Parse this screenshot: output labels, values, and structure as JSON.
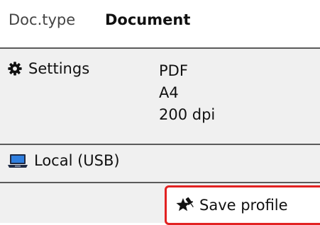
{
  "doc_type": {
    "label": "Doc.type",
    "value": "Document"
  },
  "settings": {
    "label": "Settings",
    "icon": "gear-icon",
    "values": [
      "PDF",
      "A4",
      "200 dpi"
    ]
  },
  "destination": {
    "label": "Local (USB)",
    "icon": "laptop-icon"
  },
  "save_profile": {
    "label": "Save profile",
    "icon": "star-pin-icon",
    "highlight_color": "#e22222"
  }
}
